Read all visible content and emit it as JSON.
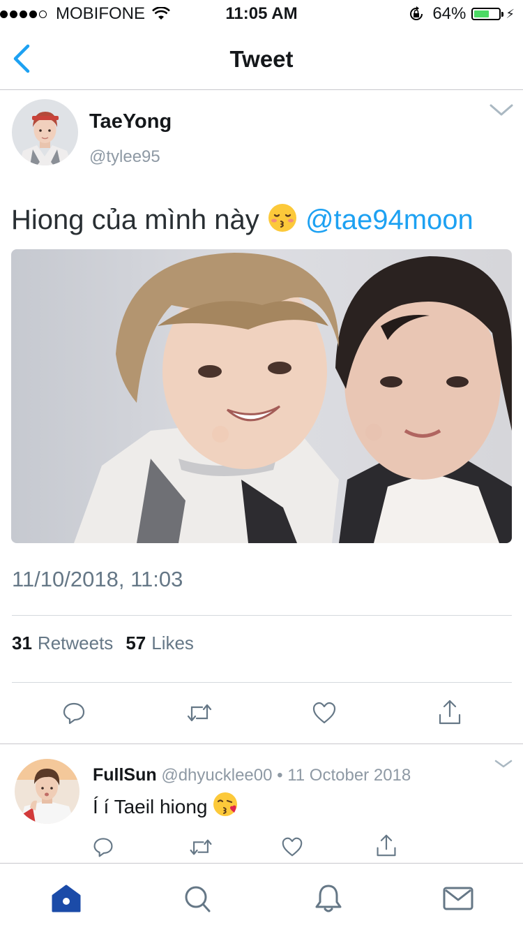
{
  "status_bar": {
    "carrier": "MOBIFONE",
    "time": "11:05 AM",
    "battery_percent": "64%",
    "battery_level": 0.64,
    "signal_bars": 4
  },
  "nav": {
    "title": "Tweet"
  },
  "tweet": {
    "author_name": "TaeYong",
    "author_handle": "@tylee95",
    "text": "Hiong của mình này",
    "mention": "@tae94moon",
    "date": "11/10/2018, 11:03",
    "retweet_count": "31",
    "retweet_label": "Retweets",
    "like_count": "57",
    "like_label": "Likes"
  },
  "reply": {
    "author_name": "FullSun",
    "author_handle": "@dhyucklee00",
    "separator": "•",
    "date": "11 October 2018",
    "text": "Í í Taeil hiong"
  },
  "colors": {
    "accent": "#1da1f2",
    "tab_active": "#1b4ba8",
    "icon_gray": "#657786"
  }
}
